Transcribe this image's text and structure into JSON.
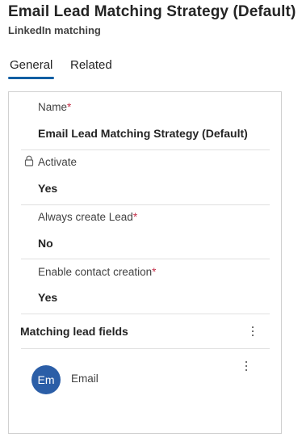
{
  "header": {
    "title": "Email Lead Matching Strategy (Default)",
    "subtitle": "LinkedIn matching"
  },
  "tabs": [
    {
      "label": "General",
      "selected": true
    },
    {
      "label": "Related",
      "selected": false
    }
  ],
  "form": {
    "fields": [
      {
        "label": "Name",
        "required": true,
        "locked": false,
        "value": "Email Lead Matching Strategy (Default)"
      },
      {
        "label": "Activate",
        "required": false,
        "locked": true,
        "value": "Yes"
      },
      {
        "label": "Always create Lead",
        "required": true,
        "locked": false,
        "value": "No"
      },
      {
        "label": "Enable contact creation",
        "required": true,
        "locked": false,
        "value": "Yes"
      }
    ],
    "required_marker": "*"
  },
  "matching_section": {
    "title": "Matching lead fields",
    "items": [
      {
        "avatar_initials": "Em",
        "name": "Email"
      }
    ]
  },
  "colors": {
    "accent": "#115ea3",
    "avatar": "#2b5ea7",
    "required": "#c4314b"
  }
}
